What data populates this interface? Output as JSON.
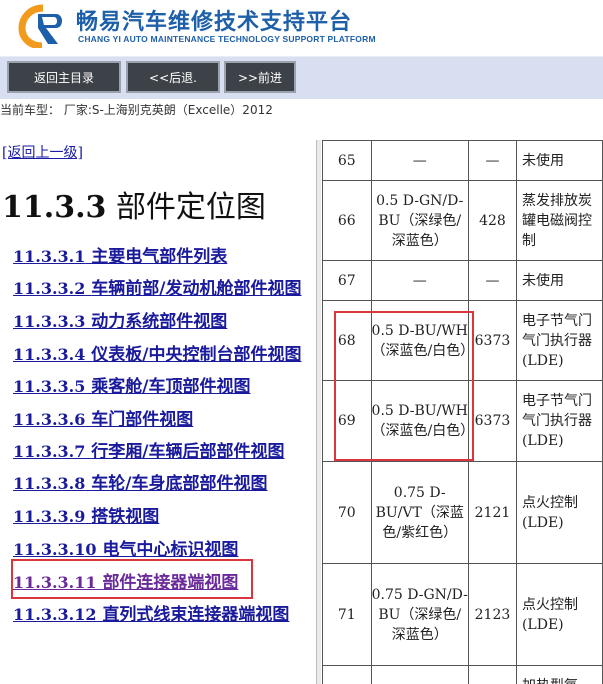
{
  "header": {
    "brand": "畅易汽车维修技术支持平台",
    "brand_sub": "CHANG YI AUTO MAINTENANCE TECHNOLOGY SUPPORT PLATFORM"
  },
  "toolbar": {
    "home_label": "返回主目录",
    "back_label": "<<后退.",
    "forward_label": ">>前进"
  },
  "vehicle_info": "当前车型： 厂家:S-上海别克英朗（Excelle）2012",
  "back_up_label": "[返回上一级]",
  "section": {
    "num": "11.3.3",
    "title": "部件定位图"
  },
  "nav": [
    {
      "num": "11.3.3.1",
      "label": "主要电气部件列表"
    },
    {
      "num": "11.3.3.2",
      "label": "车辆前部/发动机舱部件视图"
    },
    {
      "num": "11.3.3.3",
      "label": "动力系统部件视图"
    },
    {
      "num": "11.3.3.4",
      "label": "仪表板/中央控制台部件视图"
    },
    {
      "num": "11.3.3.5",
      "label": "乘客舱/车顶部件视图"
    },
    {
      "num": "11.3.3.6",
      "label": "车门部件视图"
    },
    {
      "num": "11.3.3.7",
      "label": "行李厢/车辆后部部件视图"
    },
    {
      "num": "11.3.3.8",
      "label": "车轮/车身底部部件视图"
    },
    {
      "num": "11.3.3.9",
      "label": "搭铁视图"
    },
    {
      "num": "11.3.3.10",
      "label": "电气中心标识视图"
    },
    {
      "num": "11.3.3.11",
      "label": "部件连接器端视图"
    },
    {
      "num": "11.3.3.12",
      "label": "直列式线束连接器端视图"
    }
  ],
  "table": {
    "rows": [
      {
        "pin": "65",
        "wire": "—",
        "circuit": "—",
        "func": "未使用"
      },
      {
        "pin": "66",
        "wire": "0.5 D-GN/D-BU（深绿色/深蓝色）",
        "circuit": "428",
        "func": "蒸发排放炭罐电磁阀控制"
      },
      {
        "pin": "67",
        "wire": "—",
        "circuit": "—",
        "func": "未使用"
      },
      {
        "pin": "68",
        "wire": "0.5 D-BU/WH（深蓝色/白色）",
        "circuit": "6373",
        "func": "电子节气门气门执行器(LDE)"
      },
      {
        "pin": "69",
        "wire": "0.5 D-BU/WH（深蓝色/白色）",
        "circuit": "6373",
        "func": "电子节气门气门执行器(LDE)"
      },
      {
        "pin": "70",
        "wire": "0.75 D-BU/VT（深蓝色/紫红色）",
        "circuit": "2121",
        "func": "点火控制(LDE)"
      },
      {
        "pin": "71",
        "wire": "0.75 D-GN/D-BU（深绿色/深蓝色）",
        "circuit": "2123",
        "func": "点火控制(LDE)"
      },
      {
        "pin": "",
        "wire": "",
        "circuit": "",
        "func": "加热型氧"
      }
    ]
  }
}
